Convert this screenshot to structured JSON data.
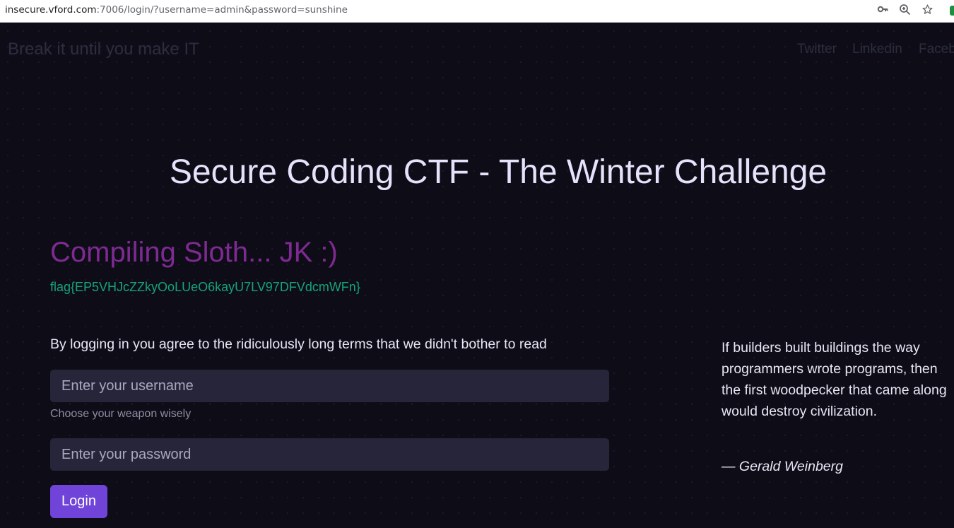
{
  "browser": {
    "url_host": "insecure.vford.com",
    "url_rest": ":7006/login/?username=admin&password=sunshine",
    "icons": [
      "key-icon",
      "zoom-icon",
      "star-icon"
    ]
  },
  "navbar": {
    "brand": "Break it until you make IT",
    "links": [
      "Twitter",
      "Linkedin",
      "Facebook"
    ]
  },
  "hero": {
    "title": "Secure Coding CTF - The Winter Challenge"
  },
  "status": {
    "heading": "Compiling Sloth... JK :)",
    "flag": "flag{EP5VHJcZZkyOoLUeO6kayU7LV97DFVdcmWFn}"
  },
  "login": {
    "terms": "By logging in you agree to the ridiculously long terms that we didn't bother to read",
    "username_placeholder": "Enter your username",
    "username_hint": "Choose your weapon wisely",
    "password_placeholder": "Enter your password",
    "button_label": "Login"
  },
  "quote": {
    "text": "If builders built buildings the way programmers wrote programs, then the first woodpecker that came along would destroy civilization.",
    "author": "— Gerald Weinberg"
  },
  "colors": {
    "background": "#0e0d17",
    "accent_purple": "#7e2a92",
    "flag_green": "#16a37a",
    "button": "#7044d8"
  }
}
